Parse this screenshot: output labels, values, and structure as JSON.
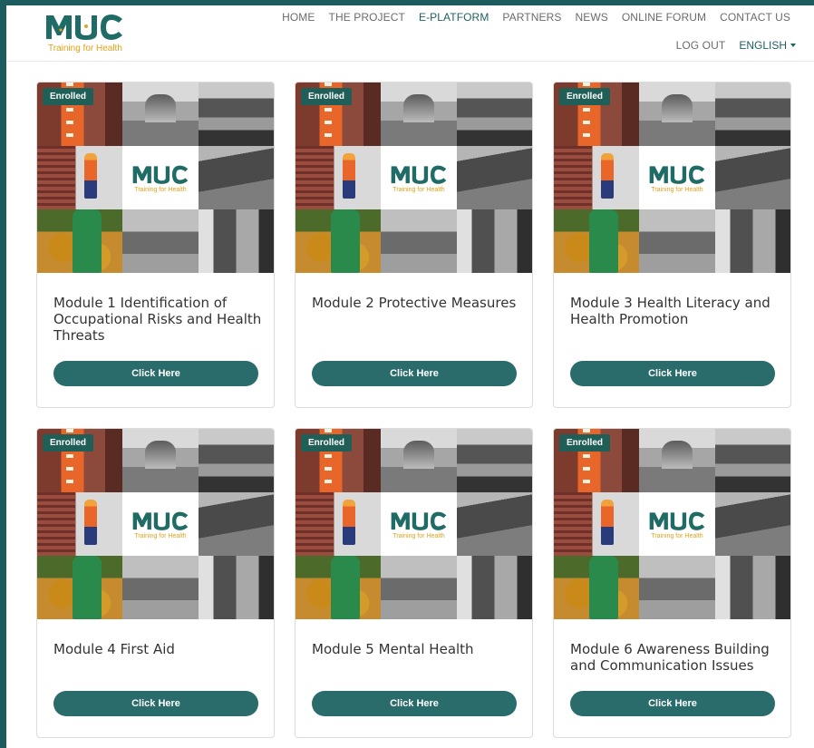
{
  "brand": {
    "logo_text": "MUC",
    "tagline": "Training for Health",
    "accent": "#e3a21a",
    "primary": "#1f5f63"
  },
  "nav": {
    "top": [
      "HOME",
      "THE PROJECT",
      "E-PLATFORM",
      "PARTNERS",
      "NEWS",
      "ONLINE FORUM",
      "CONTACT US"
    ],
    "active": "E-PLATFORM",
    "logout": "LOG OUT",
    "language": "ENGLISH"
  },
  "modules": [
    {
      "badge": "Enrolled",
      "title": "Module 1 Identification of Occupational Risks and Health Threats",
      "button": "Click Here"
    },
    {
      "badge": "Enrolled",
      "title": "Module 2 Protective Measures",
      "button": "Click Here"
    },
    {
      "badge": "Enrolled",
      "title": "Module 3 Health Literacy and Health Promotion",
      "button": "Click Here"
    },
    {
      "badge": "Enrolled",
      "title": "Module 4 First Aid",
      "button": "Click Here"
    },
    {
      "badge": "Enrolled",
      "title": "Module 5 Mental Health",
      "button": "Click Here"
    },
    {
      "badge": "Enrolled",
      "title": "Module 6 Awareness Building and Communication Issues",
      "button": "Click Here"
    }
  ]
}
